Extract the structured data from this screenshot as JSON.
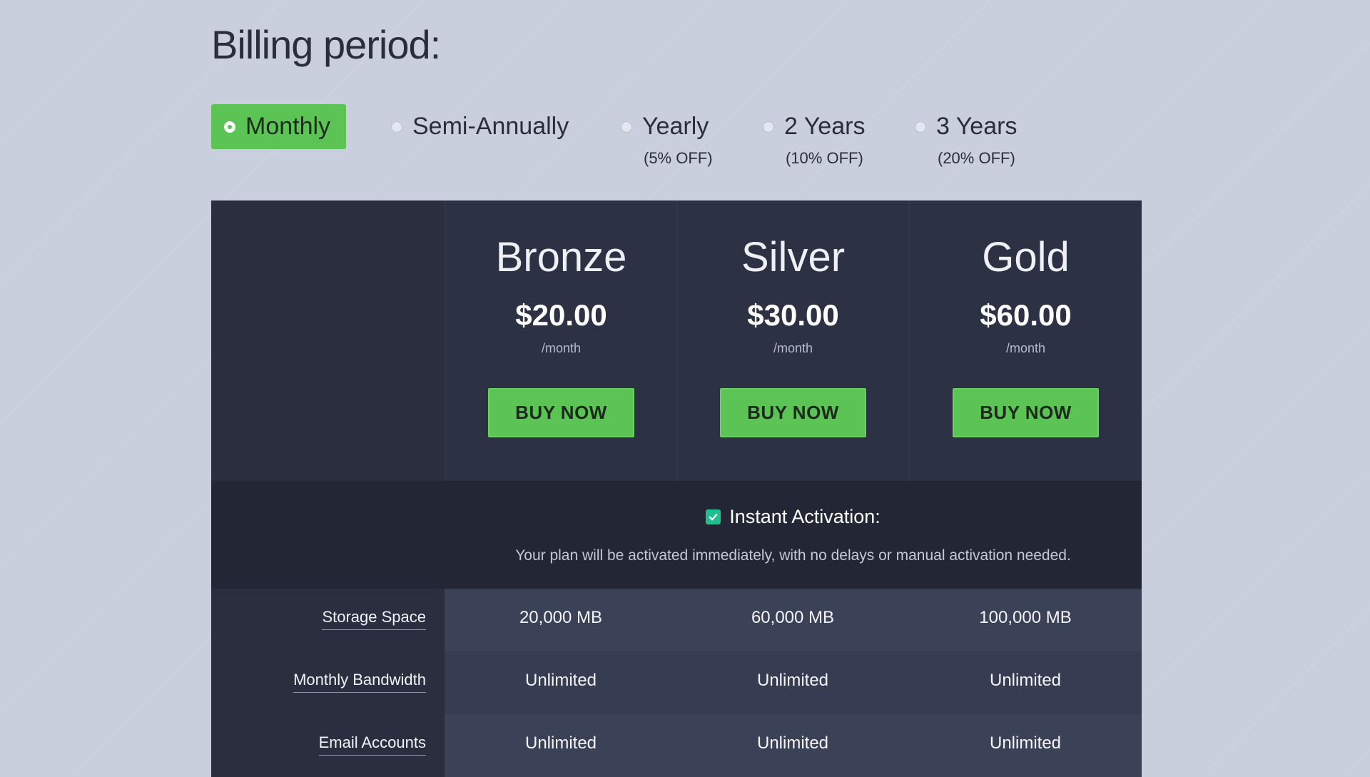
{
  "page": {
    "title": "Billing period:"
  },
  "billing_periods": [
    {
      "label": "Monthly",
      "discount": "",
      "selected": true
    },
    {
      "label": "Semi-Annually",
      "discount": "",
      "selected": false
    },
    {
      "label": "Yearly",
      "discount": "(5% OFF)",
      "selected": false
    },
    {
      "label": "2 Years",
      "discount": "(10% OFF)",
      "selected": false
    },
    {
      "label": "3 Years",
      "discount": "(20% OFF)",
      "selected": false
    }
  ],
  "plans": [
    {
      "name": "Bronze",
      "price": "$20.00",
      "term": "/month",
      "button": "BUY NOW"
    },
    {
      "name": "Silver",
      "price": "$30.00",
      "term": "/month",
      "button": "BUY NOW"
    },
    {
      "name": "Gold",
      "price": "$60.00",
      "term": "/month",
      "button": "BUY NOW"
    }
  ],
  "activation": {
    "checked": true,
    "title": "Instant Activation:",
    "description": "Your plan will be activated immediately, with no delays or manual activation needed."
  },
  "features": [
    {
      "label": "Storage Space",
      "values": [
        "20,000 MB",
        "60,000 MB",
        "100,000 MB"
      ]
    },
    {
      "label": "Monthly Bandwidth",
      "values": [
        "Unlimited",
        "Unlimited",
        "Unlimited"
      ]
    },
    {
      "label": "Email Accounts",
      "values": [
        "Unlimited",
        "Unlimited",
        "Unlimited"
      ]
    }
  ],
  "colors": {
    "accent_green": "#5cc454",
    "check_teal": "#1fbf8f",
    "background": "#c9cfdd",
    "table_dark": "#2a2e3f"
  },
  "icons": {
    "radio": "radio-button-icon",
    "check": "check-icon"
  }
}
